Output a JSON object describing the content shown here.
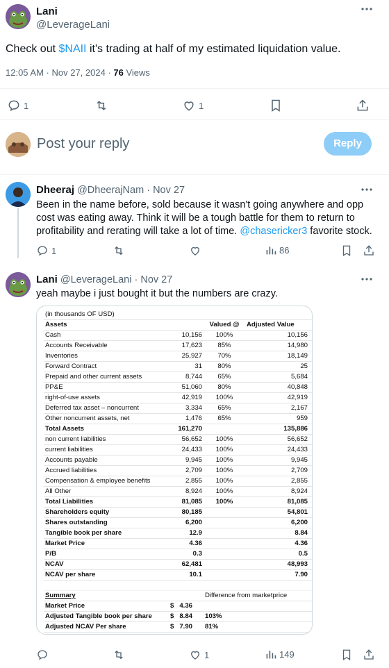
{
  "main_post": {
    "author_name": "Lani",
    "author_handle": "@LeverageLani",
    "text_before": "Check out ",
    "cashtag": "$NAII",
    "text_after": " it's trading at half of my estimated liquidation value.",
    "timestamp": "12:05 AM · Nov 27, 2024 · ",
    "views_count": "76",
    "views_label": " Views",
    "reply_count": "1",
    "like_count": "1"
  },
  "composer": {
    "placeholder": "Post your reply",
    "reply_button": "Reply"
  },
  "reply1": {
    "author_name": "Dheeraj",
    "author_handle": "@DheerajNam",
    "date": "· Nov 27",
    "text_before": "Been in the name before, sold because it wasn't going anywhere and opp cost was eating away. Think it will be a tough battle for them to return to profitability and rerating will take a lot of time. ",
    "mention": "@chasericker3",
    "text_after": " favorite stock.",
    "reply_count": "1",
    "views_count": "86"
  },
  "reply2": {
    "author_name": "Lani",
    "author_handle": "@LeverageLani",
    "date": "· Nov 27",
    "text": "yeah maybe i just bought it but the numbers are crazy.",
    "like_count": "1",
    "views_count": "149"
  },
  "sheet": {
    "unit_note": "(in thousands OF USD)",
    "header": [
      "Assets",
      "",
      "Valued @",
      "Adjusted Value"
    ],
    "rows": [
      {
        "label": "Cash",
        "value": "10,156",
        "pct": "100%",
        "adj": "10,156"
      },
      {
        "label": "Accounts Receivable",
        "value": "17,623",
        "pct": "85%",
        "adj": "14,980"
      },
      {
        "label": "Inventories",
        "value": "25,927",
        "pct": "70%",
        "adj": "18,149"
      },
      {
        "label": "Forward Contract",
        "value": "31",
        "pct": "80%",
        "adj": "25"
      },
      {
        "label": "Prepaid and other current assets",
        "value": "8,744",
        "pct": "65%",
        "adj": "5,684"
      },
      {
        "label": "PP&E",
        "value": "51,060",
        "pct": "80%",
        "adj": "40,848"
      },
      {
        "label": "right-of-use assets",
        "value": "42,919",
        "pct": "100%",
        "adj": "42,919"
      },
      {
        "label": "Deferred tax asset – noncurrent",
        "value": "3,334",
        "pct": "65%",
        "adj": "2,167"
      },
      {
        "label": "Other noncurrent assets, net",
        "value": "1,476",
        "pct": "65%",
        "adj": "959"
      },
      {
        "label": "Total Assets",
        "value": "161,270",
        "pct": "",
        "adj": "135,886",
        "bold": true
      },
      {
        "label": "non current liabilities",
        "value": "56,652",
        "pct": "100%",
        "adj": "56,652"
      },
      {
        "label": "current liabilities",
        "value": "24,433",
        "pct": "100%",
        "adj": "24,433"
      },
      {
        "label": "Accounts payable",
        "value": "9,945",
        "pct": "100%",
        "adj": "9,945"
      },
      {
        "label": "Accrued liabilities",
        "value": "2,709",
        "pct": "100%",
        "adj": "2,709"
      },
      {
        "label": "Compensation & employee benefits",
        "value": "2,855",
        "pct": "100%",
        "adj": "2,855"
      },
      {
        "label": "All Other",
        "value": "8,924",
        "pct": "100%",
        "adj": "8,924"
      },
      {
        "label": "Total Liabilities",
        "value": "81,085",
        "pct": "100%",
        "adj": "81,085",
        "bold": true
      },
      {
        "label": "Shareholders equity",
        "value": "80,185",
        "pct": "",
        "adj": "54,801",
        "bold": true
      },
      {
        "label": "Shares outstanding",
        "value": "6,200",
        "pct": "",
        "adj": "6,200",
        "bold": true
      },
      {
        "label": "Tangible book per share",
        "value": "12.9",
        "pct": "",
        "adj": "8.84",
        "bold": true
      },
      {
        "label": "Market Price",
        "value": "4.36",
        "pct": "",
        "adj": "4.36",
        "bold": true
      },
      {
        "label": "P/B",
        "value": "0.3",
        "pct": "",
        "adj": "0.5",
        "bold": true
      },
      {
        "label": "NCAV",
        "value": "62,481",
        "pct": "",
        "adj": "48,993",
        "bold": true
      },
      {
        "label": "NCAV per share",
        "value": "10.1",
        "pct": "",
        "adj": "7.90",
        "bold": true
      }
    ],
    "summary_label": "Summary",
    "summary_header": "Difference from marketprice",
    "summary_rows": [
      {
        "label": "Market Price",
        "value": "$   4.36",
        "diff": ""
      },
      {
        "label": "Adjusted Tangible book per share",
        "value": "$   8.84",
        "diff": "103%"
      },
      {
        "label": "Adjusted NCAV Per share",
        "value": "$   7.90",
        "diff": "81%"
      }
    ]
  }
}
